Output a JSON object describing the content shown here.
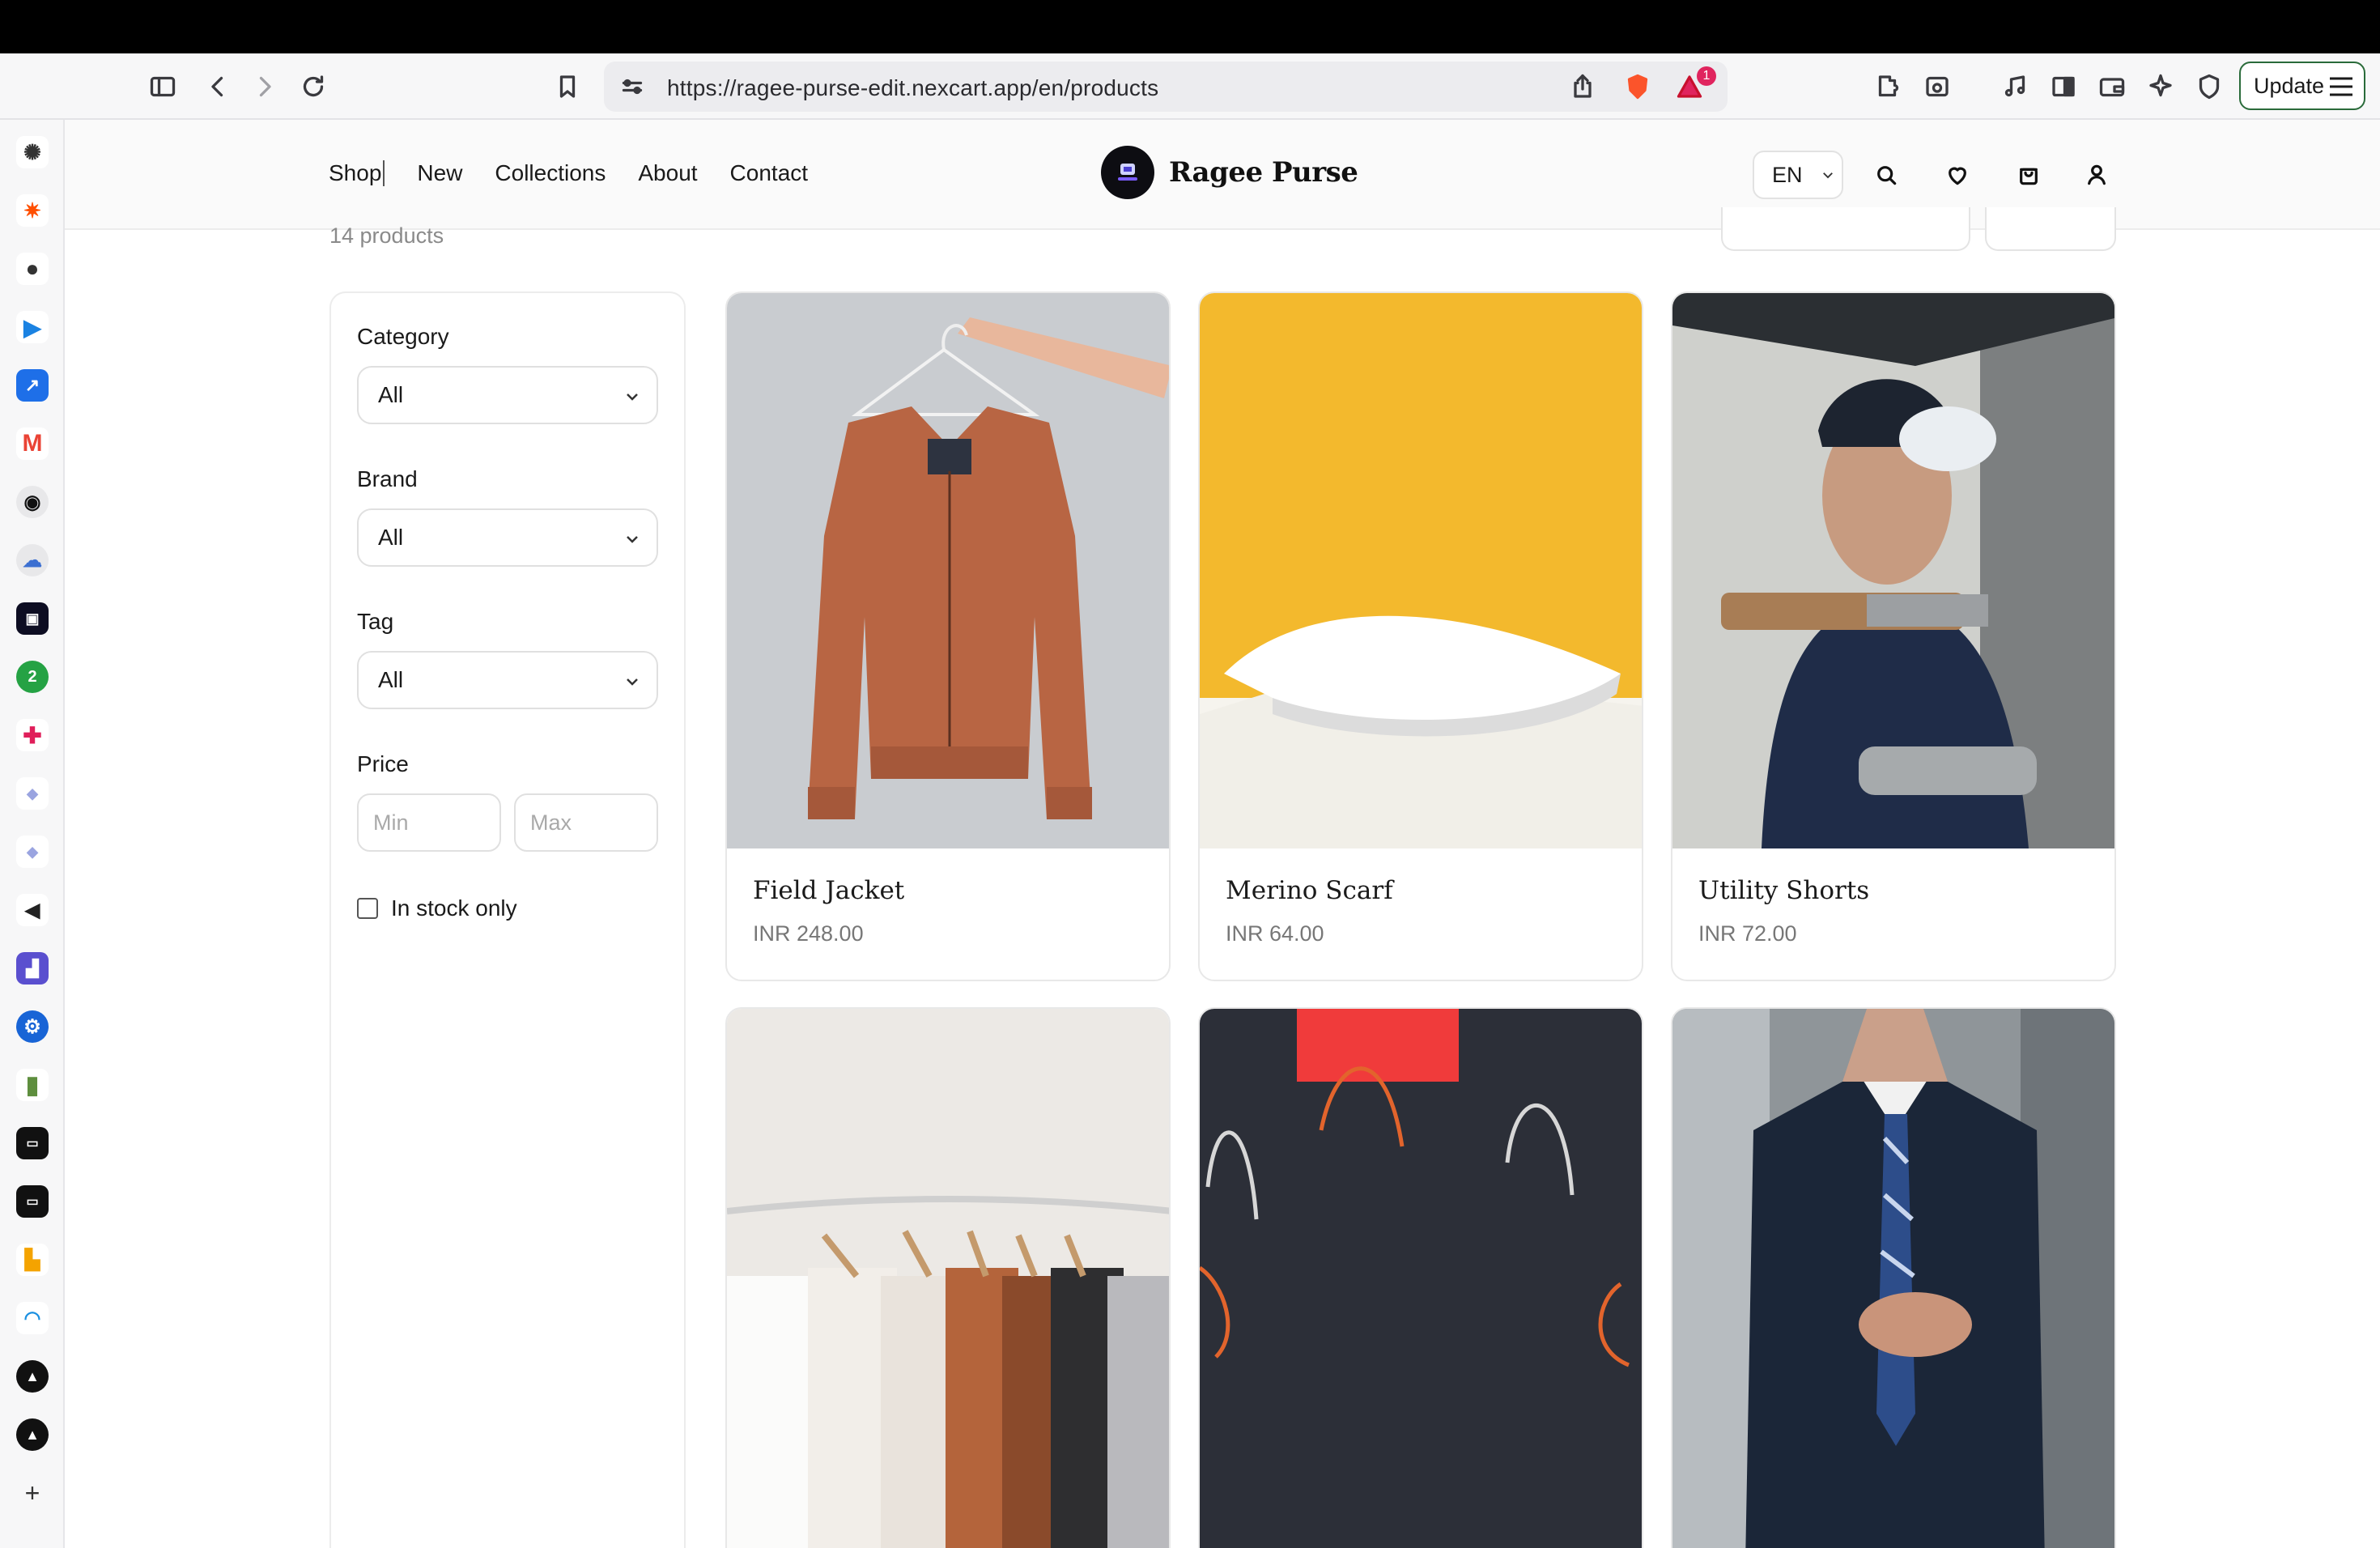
{
  "browser": {
    "url": "https://ragee-purse-edit.nexcart.app/en/products",
    "update_label": "Update",
    "brave_badge_count": "1"
  },
  "header": {
    "nav": [
      "Shop",
      "New",
      "Collections",
      "About",
      "Contact"
    ],
    "brand_name": "Ragee Purse",
    "language": "EN"
  },
  "listing": {
    "count_text": "14 products"
  },
  "filters": {
    "category": {
      "label": "Category",
      "value": "All"
    },
    "brand": {
      "label": "Brand",
      "value": "All"
    },
    "tag": {
      "label": "Tag",
      "value": "All"
    },
    "price": {
      "label": "Price",
      "min_placeholder": "Min",
      "max_placeholder": "Max"
    },
    "in_stock_label": "In stock only"
  },
  "products": [
    {
      "name": "Field Jacket",
      "price": "INR 248.00"
    },
    {
      "name": "Merino Scarf",
      "price": "INR 64.00"
    },
    {
      "name": "Utility Shorts",
      "price": "INR 72.00"
    },
    {
      "name": "",
      "price": ""
    },
    {
      "name": "",
      "price": ""
    },
    {
      "name": "",
      "price": ""
    }
  ],
  "dock": {
    "icons": [
      "openai-icon",
      "zapier-icon",
      "apple-icon",
      "sendgrid-icon",
      "tasks-icon",
      "gmail-icon",
      "github-icon",
      "cloud-icon",
      "nexcart-icon",
      "whatsapp-icon",
      "slack-icon",
      "gem-icon",
      "gem-icon-2",
      "speaker-icon",
      "chart-app-icon",
      "settings-app-icon",
      "shopify-icon",
      "terminal-icon",
      "terminal-icon-2",
      "analytics-icon",
      "arc-icon",
      "vercel-icon",
      "vercel-icon-2",
      "add-icon"
    ],
    "whatsapp_badge": "2"
  }
}
